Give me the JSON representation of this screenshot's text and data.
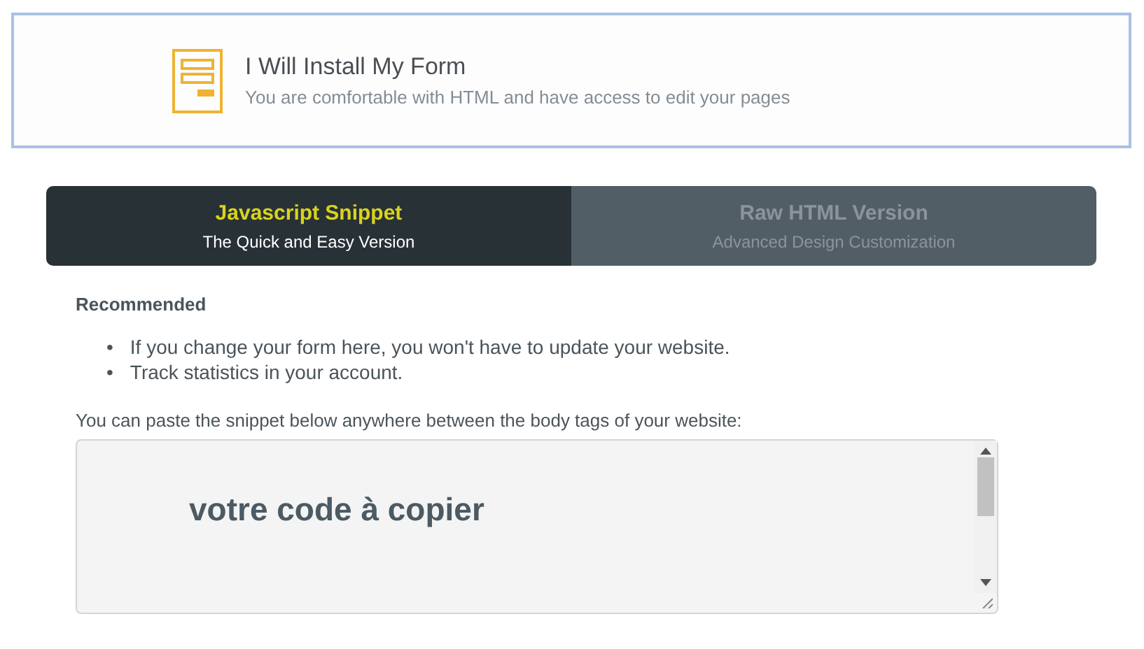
{
  "install_option": {
    "title": "I Will Install My Form",
    "subtitle": "You are comfortable with HTML and have access to edit your pages"
  },
  "tabs": [
    {
      "title": "Javascript Snippet",
      "subtitle": "The Quick and Easy Version",
      "selected": true
    },
    {
      "title": "Raw HTML Version",
      "subtitle": "Advanced Design Customization",
      "selected": false
    }
  ],
  "content": {
    "heading": "Recommended",
    "bullets": [
      {
        "marker": "•",
        "text": "If you change your form here, you won't have to update your website."
      },
      {
        "marker": "•",
        "text": "Track statistics in your account."
      }
    ],
    "instruction": "You can paste the snippet below anywhere between the body tags of your website:",
    "code_field": {
      "value": "votre code à copier"
    }
  }
}
